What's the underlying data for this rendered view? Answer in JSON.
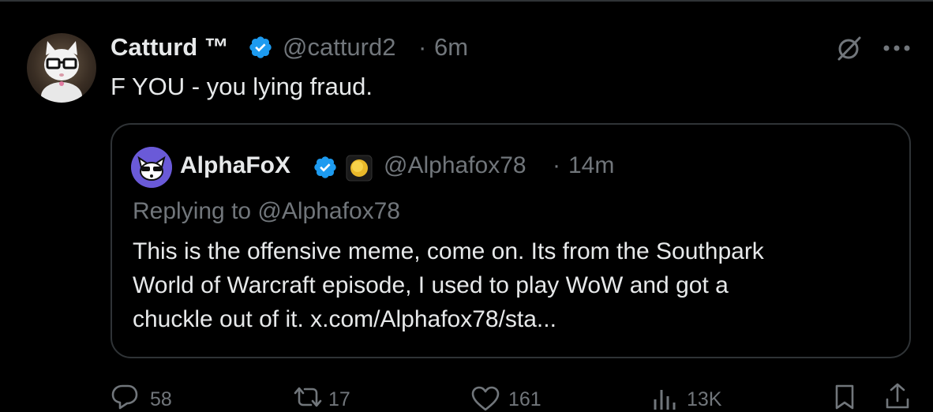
{
  "tweet": {
    "author_name": "Catturd ™",
    "handle": "@catturd2",
    "separator": "·",
    "time": "6m",
    "text": "F YOU - you lying fraud."
  },
  "quoted_tweet": {
    "author_name": "AlphaFoX",
    "handle": "@Alphafox78",
    "separator": "·",
    "time": "14m",
    "replying_to": "Replying to @Alphafox78",
    "lines": [
      "This is the offensive meme, come on. Its from the Southpark",
      "World of Warcraft episode, I used to play WoW and got a",
      "chuckle out of it. x.com/Alphafox78/sta..."
    ]
  },
  "actions": {
    "replies": "58",
    "reposts": "17",
    "likes": "161",
    "views": "13K"
  },
  "colors": {
    "background": "#000000",
    "text": "#e7e9ea",
    "muted": "#71767b",
    "border": "#2f3336",
    "verified": "#1d9bf0"
  },
  "icons": [
    "verified-badge-icon",
    "grok-icon",
    "more-icon",
    "gold-coin-icon",
    "reply-icon",
    "repost-icon",
    "like-icon",
    "views-icon",
    "bookmark-icon",
    "share-icon"
  ]
}
